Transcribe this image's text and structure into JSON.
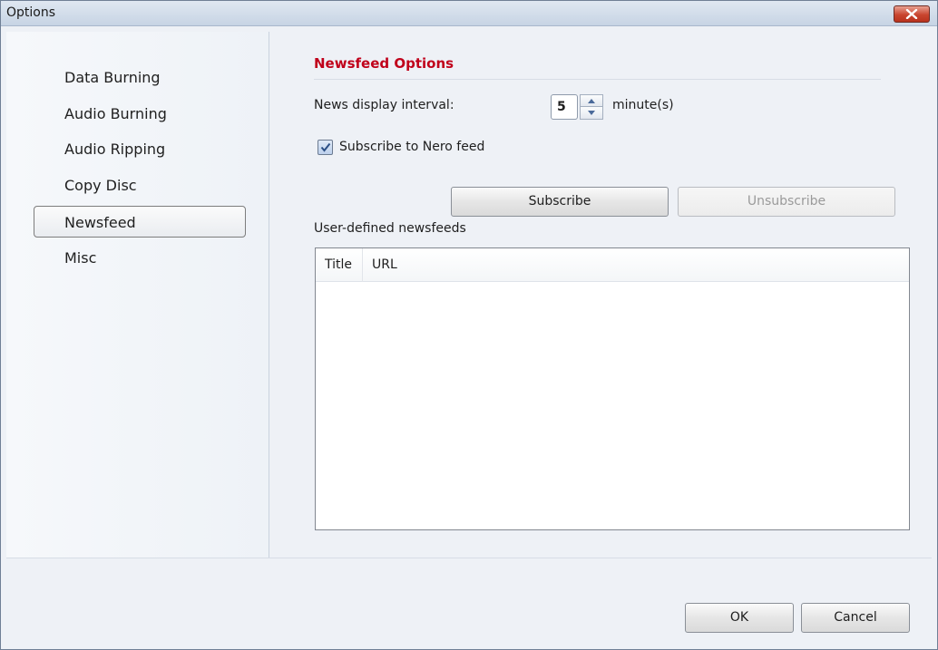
{
  "window": {
    "title": "Options"
  },
  "nav": {
    "items": [
      {
        "label": "Data Burning"
      },
      {
        "label": "Audio Burning"
      },
      {
        "label": "Audio Ripping"
      },
      {
        "label": "Copy Disc"
      },
      {
        "label": "Newsfeed",
        "selected": true
      },
      {
        "label": "Misc"
      }
    ]
  },
  "newsfeed": {
    "section_title": "Newsfeed Options",
    "interval_label": "News display interval:",
    "interval_value": "5",
    "interval_unit": "minute(s)",
    "subscribe_checkbox_label": "Subscribe to Nero feed",
    "subscribe_checked": true,
    "subscribe_button": "Subscribe",
    "unsubscribe_button": "Unsubscribe",
    "user_feeds_label": "User-defined newsfeeds",
    "columns": [
      "Title",
      "URL"
    ],
    "rows": []
  },
  "footer": {
    "ok_button": "OK",
    "cancel_button": "Cancel"
  },
  "colors": {
    "section_title": "#c0001a",
    "close_button": "#c9452f"
  }
}
